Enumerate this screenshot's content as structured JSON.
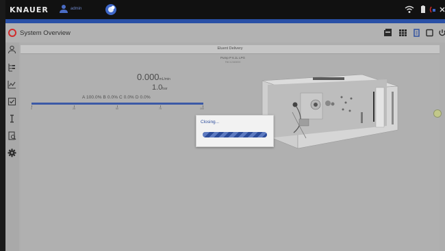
{
  "app": {
    "brand": "KNAUER",
    "username": "admin",
    "page_title": "System Overview"
  },
  "panel": {
    "header": "Eluent Delivery",
    "pump_name": "Pump P 6.1L LPG",
    "pump_serial": "FBC12345000",
    "flow_value": "0.000",
    "flow_unit": "mL/min",
    "pressure_value": "1.0",
    "pressure_unit": "bar",
    "composition": "A 100.0% B 0.0% C 0.0% D 0.0%",
    "scale_ticks": [
      "0",
      "25",
      "50",
      "75",
      "100"
    ]
  },
  "dialog": {
    "message": "Closing...",
    "progress_percent": 100
  },
  "colors": {
    "topbar": "#111111",
    "accent": "#2950a6",
    "background": "#aeaeae",
    "status_circle": "#d12a2a"
  },
  "icons": {
    "topbar_right": [
      "wifi-icon",
      "battery-icon",
      "battery-red-icon",
      "close-icon"
    ],
    "toolbar": [
      "view-drawer-icon",
      "grid-icon",
      "device-icon",
      "window-icon",
      "power-icon"
    ],
    "sidebar": [
      "user-icon",
      "tree-icon",
      "chart-icon",
      "checklist-icon",
      "column-icon",
      "report-icon",
      "gear-icon"
    ]
  }
}
